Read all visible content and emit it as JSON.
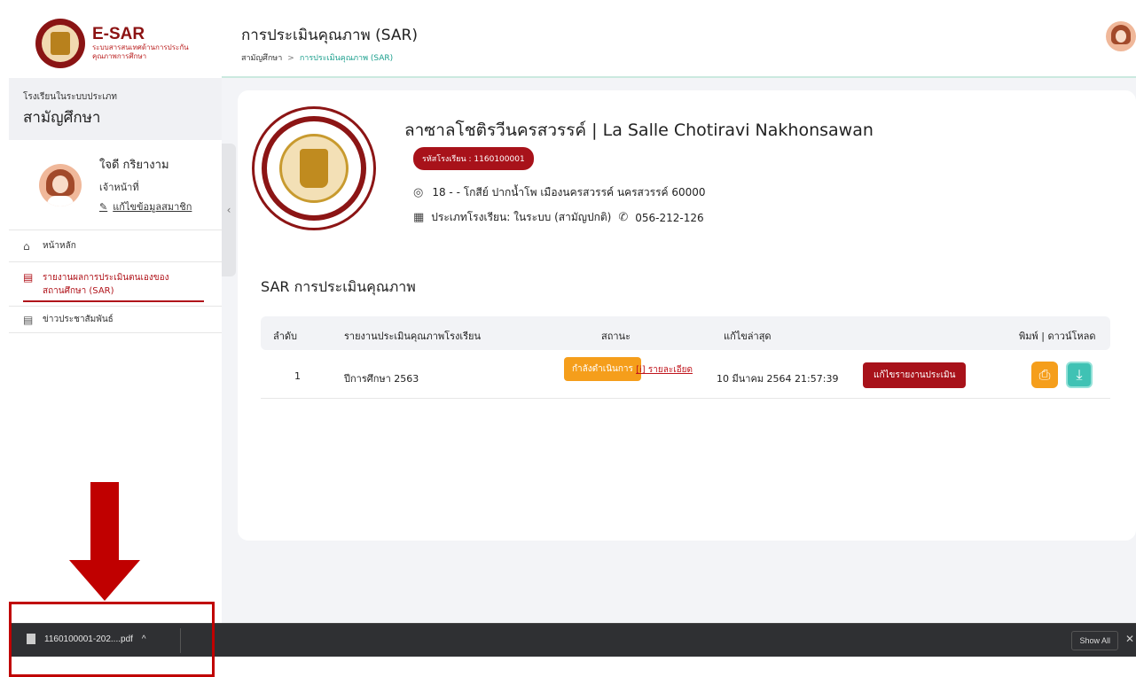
{
  "brand": {
    "title": "E-SAR",
    "subtitle_line1": "ระบบสารสนเทศด้านการประกัน",
    "subtitle_line2": "คุณภาพการศึกษา"
  },
  "sidebar": {
    "school_type_label": "โรงเรียนในระบบประเภท",
    "school_type_value": "สามัญศึกษา",
    "user": {
      "name": "ใจดี กริยางาม",
      "role": "เจ้าหน้าที่",
      "edit_link": "แก้ไขข้อมูลสมาชิก"
    },
    "items": [
      {
        "label": "หน้าหลัก",
        "icon": "home-icon"
      },
      {
        "label_line1": "รายงานผลการประเมินตนเองของ",
        "label_line2": "สถานศึกษา (SAR)",
        "icon": "document-icon"
      },
      {
        "label": "ข่าวประชาสัมพันธ์",
        "icon": "document-icon"
      }
    ]
  },
  "header": {
    "title": "การประเมินคุณภาพ (SAR)",
    "breadcrumb": [
      "สามัญศึกษา",
      "การประเมินคุณภาพ (SAR)"
    ]
  },
  "school": {
    "name": "ลาซาลโชติรวีนครสวรรค์ | La Salle Chotiravi Nakhonsawan",
    "code": "รหัสโรงเรียน : 1160100001",
    "address": "18 - - โกสีย์ ปากน้ำโพ เมืองนครสวรรค์ นครสวรรค์ 60000",
    "type": "ประเภทโรงเรียน: ในระบบ (สามัญปกติ)",
    "phone": "056-212-126"
  },
  "sar": {
    "title": "SAR การประเมินคุณภาพ",
    "columns": [
      "ลำดับ",
      "รายงานประเมินคุณภาพโรงเรียน",
      "สถานะ",
      "แก้ไขล่าสุด",
      "พิมพ์ | ดาวน์โหลด"
    ],
    "rows": [
      {
        "index": "1",
        "report": "ปีการศึกษา 2563",
        "status": "กำลังดำเนินการ",
        "detail": "[i] รายละเอียด",
        "last_edit": "10 มีนาคม 2564 21:57:39",
        "edit_button": "แก้ไขรายงานประเมิน"
      }
    ]
  },
  "download_bar": {
    "filename": "1160100001-202....pdf",
    "show_all": "Show All"
  },
  "colors": {
    "accent_red": "#a8121a",
    "status_orange": "#f59e1b",
    "teal": "#3fc2b4",
    "annotation_red": "#c00000"
  }
}
